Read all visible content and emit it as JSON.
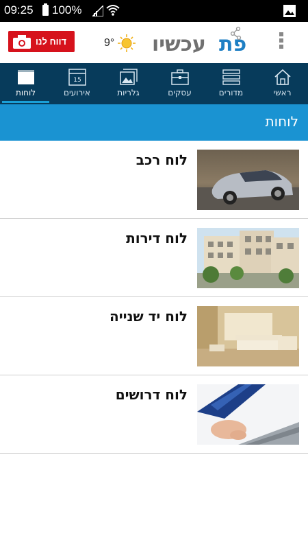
{
  "status_bar": {
    "time": "09:25",
    "battery": "100%"
  },
  "app_bar": {
    "report_button": "דווח לנו",
    "temperature": "9°",
    "weather_icon": "sun-icon",
    "logo_text": "עכשיו",
    "logo_brand": "פת"
  },
  "nav": {
    "items": [
      {
        "label": "ראשי",
        "icon": "home-icon"
      },
      {
        "label": "מדורים",
        "icon": "sections-icon"
      },
      {
        "label": "עסקים",
        "icon": "briefcase-icon"
      },
      {
        "label": "גלריות",
        "icon": "gallery-icon"
      },
      {
        "label": "אירועים",
        "icon": "calendar-icon",
        "day": "15"
      },
      {
        "label": "לוחות",
        "icon": "board-icon",
        "active": true
      }
    ]
  },
  "section": {
    "title": "לוחות"
  },
  "boards": [
    {
      "title": "לוח רכב",
      "image": "car-photo"
    },
    {
      "title": "לוח דירות",
      "image": "apartments-photo"
    },
    {
      "title": "לוח יד שנייה",
      "image": "living-room-photo"
    },
    {
      "title": "לוח דרושים",
      "image": "laptop-hand-photo"
    }
  ],
  "colors": {
    "navbar": "#073b5b",
    "header": "#1a93d2",
    "report": "#d6121c",
    "accent": "#1aa0d8"
  }
}
